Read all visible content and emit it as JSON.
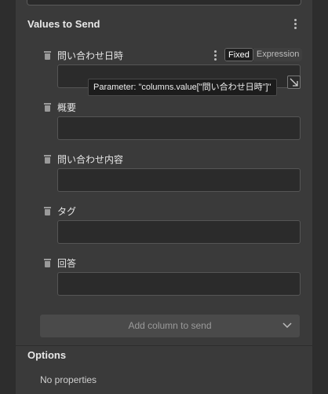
{
  "values_section": {
    "title": "Values to Send",
    "fields": [
      {
        "label": "問い合わせ日時",
        "value": ""
      },
      {
        "label": "概要",
        "value": ""
      },
      {
        "label": "問い合わせ内容",
        "value": ""
      },
      {
        "label": "タグ",
        "value": ""
      },
      {
        "label": "回答",
        "value": ""
      }
    ],
    "mode_toggle": {
      "fixed_label": "Fixed",
      "expression_label": "Expression",
      "selected": "Fixed"
    },
    "tooltip": "Parameter: \"columns.value[\"問い合わせ日時\"]\"",
    "add_column_label": "Add column to send"
  },
  "options_section": {
    "title": "Options",
    "empty_text": "No properties"
  },
  "icons": {
    "delete": "trash-icon",
    "menu": "kebab-menu-icon",
    "expand": "expand-icon",
    "dropdown": "chevron-down-icon"
  }
}
